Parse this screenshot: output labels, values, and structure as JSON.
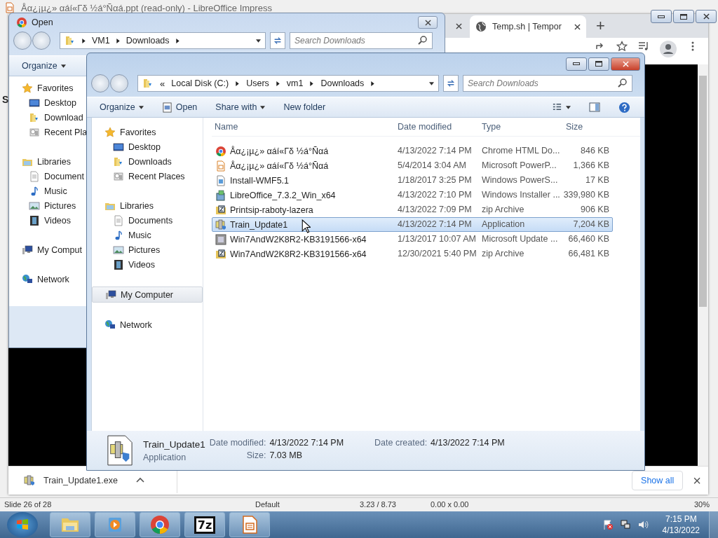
{
  "impress": {
    "title": "Åα¿¡µ¿» αáí«Γδ ½á°Ñαá.ppt (read-only) - LibreOffice Impress",
    "slide_panel_label": "S",
    "status_bar": [
      "Slide 26 of 28",
      "Default",
      "3.23 / 8.73",
      "0.00 x 0.00",
      "30%"
    ]
  },
  "chrome": {
    "tabs": [
      {
        "label": "Temp.sh | Tempor",
        "selected": true
      }
    ],
    "new_tab": "+",
    "download_bar": {
      "file": "Train_Update1.exe",
      "show_all": "Show all",
      "close": "×"
    }
  },
  "open_dialog": {
    "title": "Open",
    "path": [
      "VM1",
      "Downloads"
    ],
    "search": {
      "placeholder": "Search Downloads"
    },
    "organize": "Organize",
    "nav": [
      {
        "label": "Favorites",
        "kind": "favorites",
        "selected": false,
        "children": [
          {
            "label": "Desktop",
            "kind": "desktop",
            "selected": false
          },
          {
            "label": "Download",
            "kind": "downloads",
            "selected": false
          },
          {
            "label": "Recent Pla",
            "kind": "recent",
            "selected": false
          }
        ]
      },
      {
        "label": "Libraries",
        "kind": "libraries",
        "selected": false,
        "children": [
          {
            "label": "Document",
            "kind": "documents",
            "selected": false
          },
          {
            "label": "Music",
            "kind": "music",
            "selected": false
          },
          {
            "label": "Pictures",
            "kind": "pictures",
            "selected": false
          },
          {
            "label": "Videos",
            "kind": "videos",
            "selected": false
          }
        ]
      },
      {
        "label": "My Comput",
        "kind": "computer",
        "selected": false
      },
      {
        "label": "Network",
        "kind": "network",
        "selected": false
      }
    ]
  },
  "explorer": {
    "path_prefix": "«",
    "path": [
      "Local Disk (C:)",
      "Users",
      "vm1",
      "Downloads"
    ],
    "search": {
      "placeholder": "Search Downloads"
    },
    "toolbar": [
      {
        "label": "Organize",
        "kind": "menu"
      },
      {
        "label": "Open",
        "kind": "open"
      },
      {
        "label": "Share with",
        "kind": "menu"
      },
      {
        "label": "New folder",
        "kind": "plain"
      }
    ],
    "nav": [
      {
        "label": "Favorites",
        "kind": "favorites",
        "selected": false,
        "children": [
          {
            "label": "Desktop",
            "kind": "desktop",
            "selected": false
          },
          {
            "label": "Downloads",
            "kind": "downloads",
            "selected": false
          },
          {
            "label": "Recent Places",
            "kind": "recent",
            "selected": false
          }
        ]
      },
      {
        "label": "Libraries",
        "kind": "libraries",
        "selected": false,
        "children": [
          {
            "label": "Documents",
            "kind": "documents",
            "selected": false
          },
          {
            "label": "Music",
            "kind": "music",
            "selected": false
          },
          {
            "label": "Pictures",
            "kind": "pictures",
            "selected": false
          },
          {
            "label": "Videos",
            "kind": "videos",
            "selected": false
          }
        ]
      },
      {
        "label": "My Computer",
        "kind": "computer",
        "selected": true
      },
      {
        "label": "Network",
        "kind": "network",
        "selected": false
      }
    ],
    "columns": [
      "Name",
      "Date modified",
      "Type",
      "Size"
    ],
    "files": [
      {
        "name": "Åα¿¡µ¿» αáí«Γδ ½á°Ñαá",
        "date": "4/13/2022 7:14 PM",
        "type": "Chrome HTML Do...",
        "size": "846 KB",
        "kind": "chrome",
        "selected": false
      },
      {
        "name": "Åα¿¡µ¿» αáí«Γδ ½á°Ñαá",
        "date": "5/4/2014 3:04 AM",
        "type": "Microsoft PowerP...",
        "size": "1,366 KB",
        "kind": "slides",
        "selected": false
      },
      {
        "name": "Install-WMF5.1",
        "date": "1/18/2017 3:25 PM",
        "type": "Windows PowerS...",
        "size": "17 KB",
        "kind": "script",
        "selected": false
      },
      {
        "name": "LibreOffice_7.3.2_Win_x64",
        "date": "4/13/2022 7:10 PM",
        "type": "Windows Installer ...",
        "size": "339,980 KB",
        "kind": "installer",
        "selected": false
      },
      {
        "name": "Printsip-raboty-lazera",
        "date": "4/13/2022 7:09 PM",
        "type": "zip Archive",
        "size": "906 KB",
        "kind": "zip",
        "selected": false
      },
      {
        "name": "Train_Update1",
        "date": "4/13/2022 7:14 PM",
        "type": "Application",
        "size": "7,204 KB",
        "kind": "app",
        "selected": true
      },
      {
        "name": "Win7AndW2K8R2-KB3191566-x64",
        "date": "1/13/2017 10:07 AM",
        "type": "Microsoft Update ...",
        "size": "66,460 KB",
        "kind": "update",
        "selected": false
      },
      {
        "name": "Win7AndW2K8R2-KB3191566-x64",
        "date": "12/30/2021 5:40 PM",
        "type": "zip Archive",
        "size": "66,481 KB",
        "kind": "zip",
        "selected": false
      }
    ],
    "details": {
      "name": "Train_Update1",
      "type": "Application",
      "fields": [
        {
          "label": "Date modified:",
          "value": "4/13/2022 7:14 PM"
        },
        {
          "label": "Size:",
          "value": "7.03 MB"
        },
        {
          "label": "Date created:",
          "value": "4/13/2022 7:14 PM"
        }
      ]
    }
  },
  "taskbar": {
    "apps": [
      {
        "kind": "explorer"
      },
      {
        "kind": "media"
      },
      {
        "kind": "chrome"
      },
      {
        "kind": "sevenzip",
        "label": "7z"
      },
      {
        "kind": "impress"
      }
    ],
    "time": "7:15 PM",
    "date": "4/13/2022"
  }
}
